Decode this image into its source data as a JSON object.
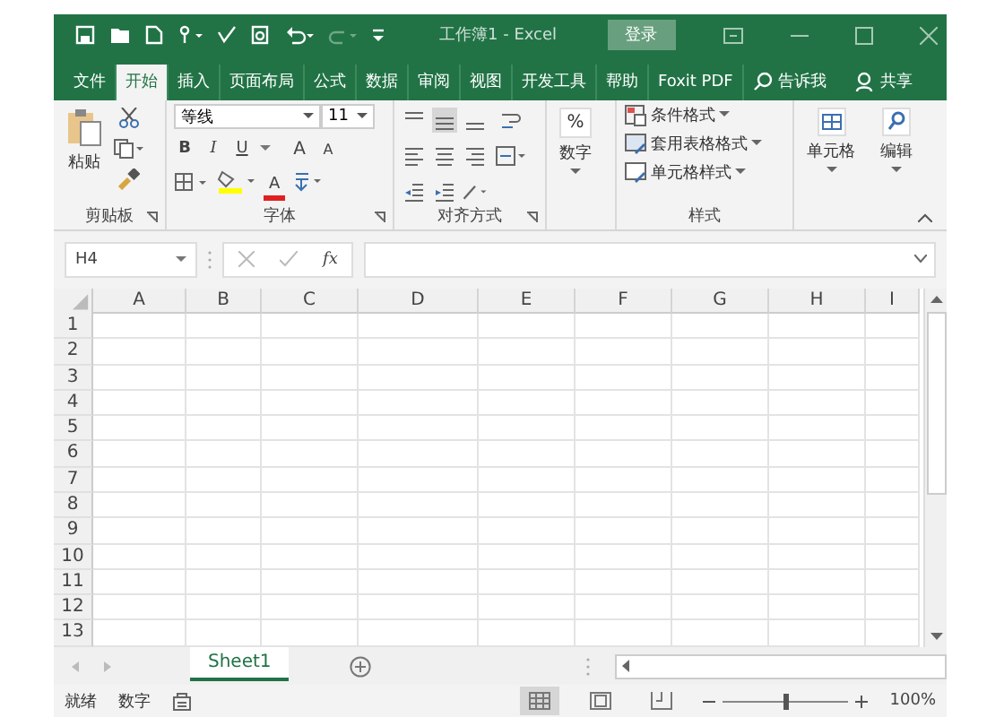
{
  "title_bar": {
    "title": "工作簿1 - Excel",
    "login_button": "登录"
  },
  "tabs": [
    {
      "label": "文件",
      "selected": false
    },
    {
      "label": "开始",
      "selected": true
    },
    {
      "label": "插入",
      "selected": false
    },
    {
      "label": "页面布局",
      "selected": false
    },
    {
      "label": "公式",
      "selected": false
    },
    {
      "label": "数据",
      "selected": false
    },
    {
      "label": "审阅",
      "selected": false
    },
    {
      "label": "视图",
      "selected": false
    },
    {
      "label": "开发工具",
      "selected": false
    },
    {
      "label": "帮助",
      "selected": false
    },
    {
      "label": "Foxit PDF",
      "selected": false
    }
  ],
  "tell_me": "告诉我",
  "share": "共享",
  "ribbon": {
    "clipboard": {
      "paste": "粘贴",
      "label": "剪贴板"
    },
    "font": {
      "name": "等线",
      "size": "11",
      "bold": "B",
      "italic": "I",
      "underline": "U",
      "grow": "A",
      "shrink": "A",
      "color_letter": "A",
      "label": "字体"
    },
    "alignment": {
      "label": "对齐方式"
    },
    "number": {
      "symbol": "%",
      "label": "数字"
    },
    "styles": {
      "items": [
        "条件格式",
        "套用表格格式",
        "单元格样式"
      ],
      "label": "样式"
    },
    "cells": "单元格",
    "editing": "编辑"
  },
  "formula_bar": {
    "name_box": "H4",
    "fx": "fx"
  },
  "sheet": {
    "columns": [
      "A",
      "B",
      "C",
      "D",
      "E",
      "F",
      "G",
      "H",
      "I"
    ],
    "rows": [
      "1",
      "2",
      "3",
      "4",
      "5",
      "6",
      "7",
      "8",
      "9",
      "10",
      "11",
      "12",
      "13"
    ]
  },
  "sheet_tabs": [
    {
      "label": "Sheet1",
      "selected": true
    }
  ],
  "status_bar": {
    "items": [
      "就绪",
      "数字"
    ],
    "zoom": "100%",
    "zoom_slider": {
      "level": 0.5
    }
  }
}
